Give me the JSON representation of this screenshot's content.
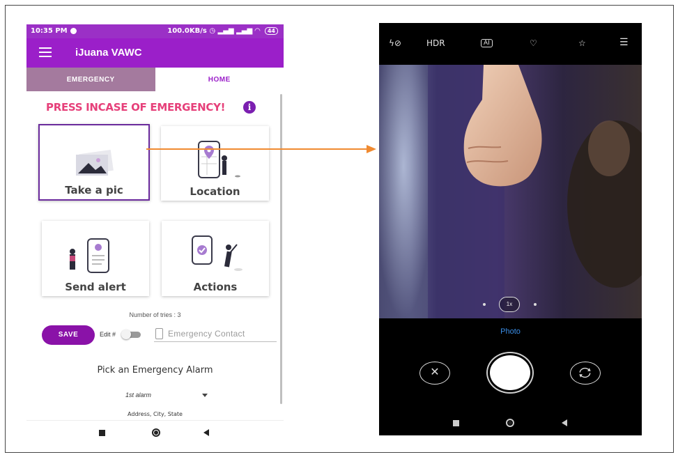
{
  "left_phone": {
    "status_bar": {
      "time": "10:35 PM",
      "network_speed": "100.0KB/s",
      "battery": "44"
    },
    "app_bar": {
      "title": "iJuana VAWC"
    },
    "tabs": [
      {
        "label": "EMERGENCY",
        "active": false
      },
      {
        "label": "HOME",
        "active": true
      }
    ],
    "headline": "PRESS INCASE OF EMERGENCY!",
    "info_icon_glyph": "i",
    "cards": [
      {
        "label": "Take a pic",
        "icon": "photo-illustration",
        "selected": true
      },
      {
        "label": "Location",
        "icon": "map-location-illustration",
        "selected": false
      },
      {
        "label": "Send alert",
        "icon": "phone-alert-illustration",
        "selected": false
      },
      {
        "label": "Actions",
        "icon": "phone-check-illustration",
        "selected": false
      }
    ],
    "tries_text": "Number of tries : 3",
    "save_label": "SAVE",
    "edit_label": "Edit #",
    "edit_toggle_on": false,
    "contact_placeholder": "Emergency Contact",
    "alarm_title": "Pick an Emergency Alarm",
    "alarm_selected": "1st alarm",
    "address_text": "Address, City, State"
  },
  "right_phone": {
    "top_icons": {
      "flash": "ϟ⊘",
      "hdr": "HDR",
      "ai": "AI"
    },
    "zoom_label": "1x",
    "mode_label": "Photo",
    "cancel_glyph": "✕"
  },
  "colors": {
    "app_purple": "#9b1fc9",
    "headline_pink": "#e6407a",
    "save_purple": "#8a12a8",
    "arrow_orange": "#f08a30",
    "photo_mode_blue": "#3b8fe8"
  }
}
